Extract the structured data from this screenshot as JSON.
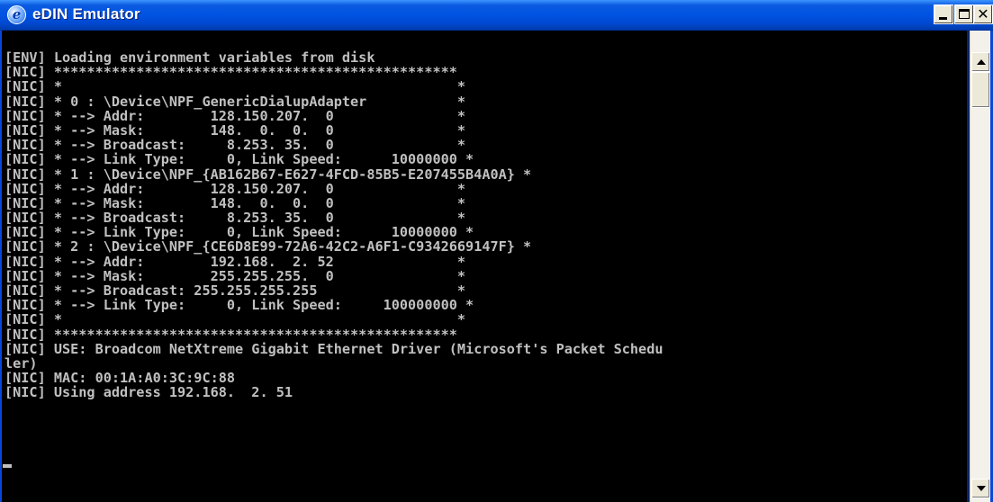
{
  "window": {
    "title": "eDIN Emulator",
    "icon": "edin-app-icon",
    "controls": {
      "minimize": "minimize-icon",
      "maximize": "maximize-icon",
      "close_label": "✕"
    }
  },
  "console": {
    "lines": [
      "[ENV] Loading environment variables from disk",
      "[NIC] *************************************************",
      "[NIC] *                                                *",
      "[NIC] * 0 : \\Device\\NPF_GenericDialupAdapter           *",
      "[NIC] * --> Addr:        128.150.207.  0               *",
      "[NIC] * --> Mask:        148.  0.  0.  0               *",
      "[NIC] * --> Broadcast:     8.253. 35.  0               *",
      "[NIC] * --> Link Type:     0, Link Speed:      10000000 *",
      "[NIC] * 1 : \\Device\\NPF_{AB162B67-E627-4FCD-85B5-E207455B4A0A} *",
      "[NIC] * --> Addr:        128.150.207.  0               *",
      "[NIC] * --> Mask:        148.  0.  0.  0               *",
      "[NIC] * --> Broadcast:     8.253. 35.  0               *",
      "[NIC] * --> Link Type:     0, Link Speed:      10000000 *",
      "[NIC] * 2 : \\Device\\NPF_{CE6D8E99-72A6-42C2-A6F1-C9342669147F} *",
      "[NIC] * --> Addr:        192.168.  2. 52               *",
      "[NIC] * --> Mask:        255.255.255.  0               *",
      "[NIC] * --> Broadcast: 255.255.255.255                 *",
      "[NIC] * --> Link Type:     0, Link Speed:     100000000 *",
      "[NIC] *                                                *",
      "[NIC] *************************************************",
      "[NIC] USE: Broadcom NetXtreme Gigabit Ethernet Driver (Microsoft's Packet Schedu",
      "ler)",
      "[NIC] MAC: 00:1A:A0:3C:9C:88",
      "[NIC] Using address 192.168.  2. 51"
    ]
  },
  "scrollbar": {
    "up_icon": "scroll-up-arrow-icon",
    "down_icon": "scroll-down-arrow-icon"
  },
  "colors": {
    "titlebar": "#0054e3",
    "console_bg": "#000000",
    "console_fg": "#c0c0c0"
  }
}
